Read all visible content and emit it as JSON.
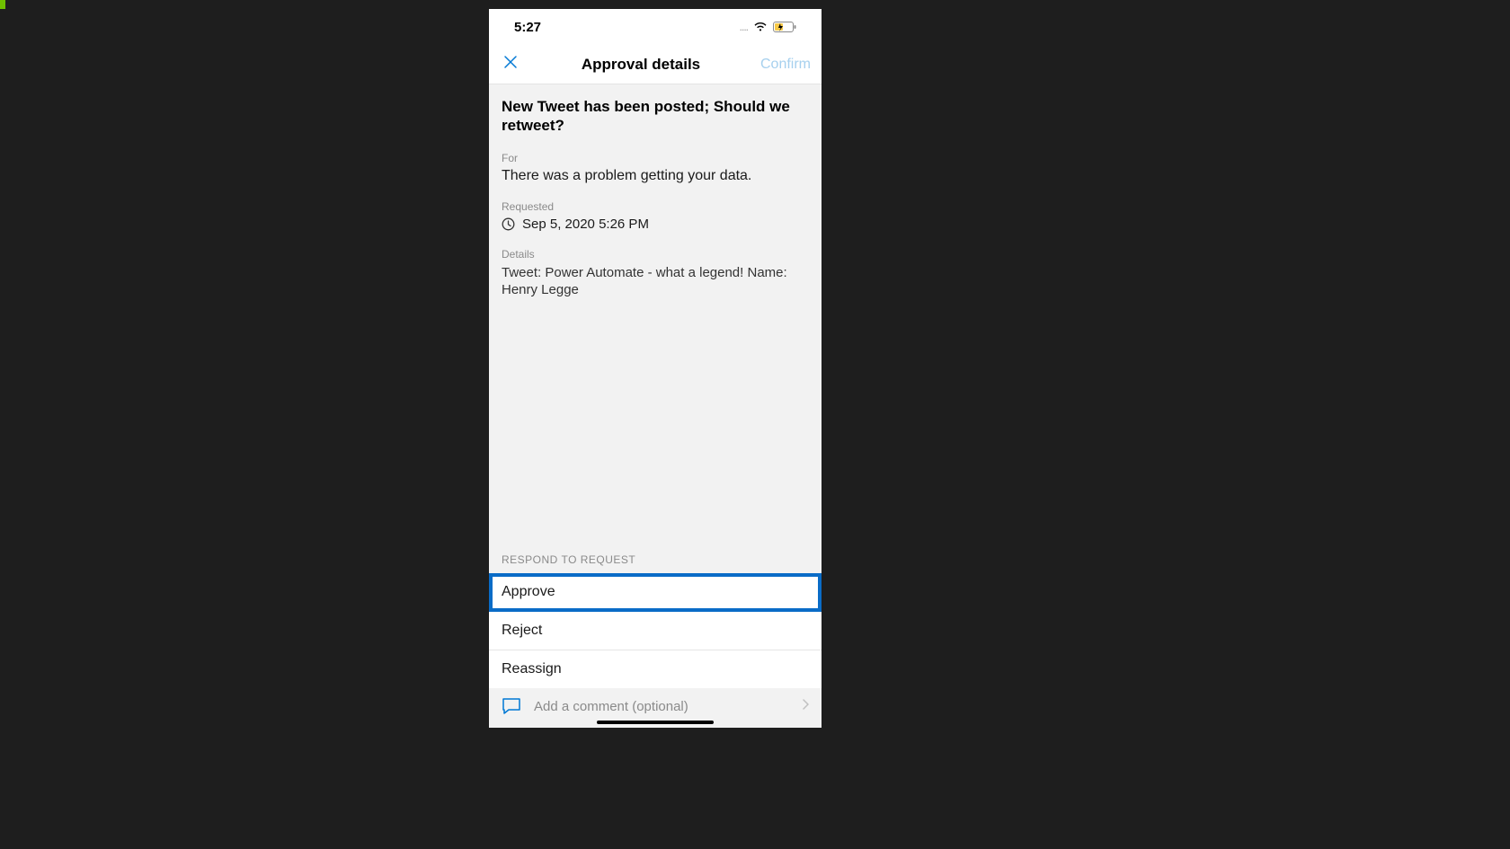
{
  "status": {
    "time": "5:27",
    "signal_dots": "....",
    "wifi": "wifi",
    "battery": "charging"
  },
  "nav": {
    "close_icon": "close",
    "title": "Approval details",
    "confirm_label": "Confirm"
  },
  "approval": {
    "title": "New Tweet has been posted; Should we retweet?",
    "for_label": "For",
    "for_value": "There was a problem getting your data.",
    "requested_label": "Requested",
    "requested_value": "Sep 5, 2020 5:26 PM",
    "details_label": "Details",
    "details_value": "Tweet: Power Automate - what a legend! Name: Henry Legge"
  },
  "respond": {
    "label": "RESPOND TO REQUEST",
    "options": {
      "approve": "Approve",
      "reject": "Reject",
      "reassign": "Reassign"
    }
  },
  "comment": {
    "placeholder": "Add a comment (optional)"
  }
}
